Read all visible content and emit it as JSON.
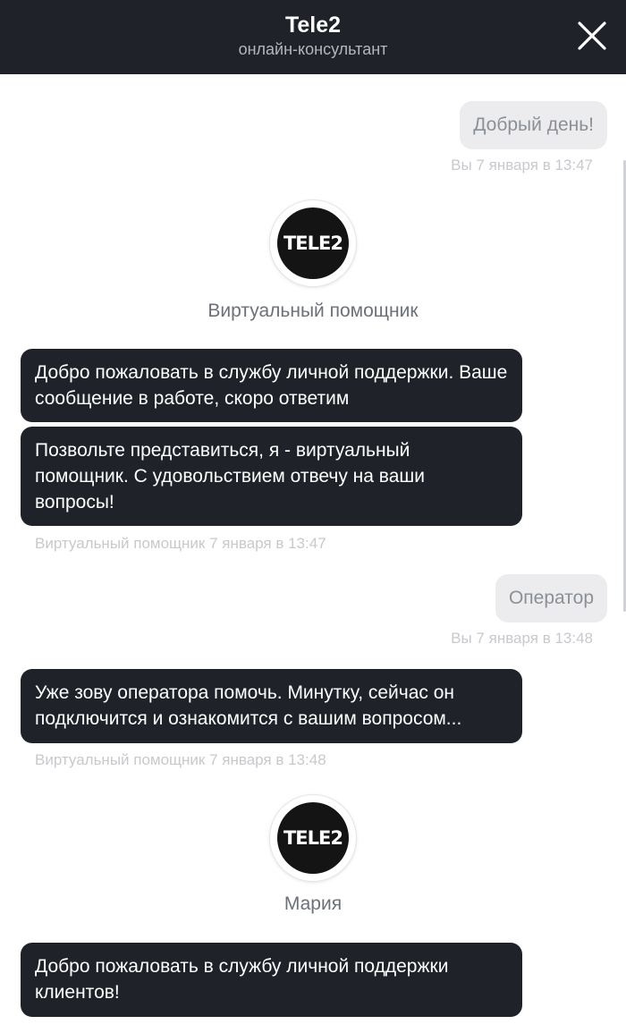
{
  "header": {
    "title": "Tele2",
    "subtitle": "онлайн-консультант",
    "close_icon": "close-icon"
  },
  "colors": {
    "header_bg": "#1f2229",
    "bot_bubble_bg": "#1f2229",
    "user_bubble_bg": "#ececee",
    "meta_text": "#c7c9cd"
  },
  "messages": [
    {
      "from": "user",
      "text": "Добрый день!",
      "meta": "Вы 7 января в 13:47"
    },
    {
      "agent": {
        "logo": "TELE2",
        "name": "Виртуальный помощник"
      }
    },
    {
      "from": "bot",
      "text": "Добро пожаловать в службу личной поддержки. Ваше сообщение в работе, скоро ответим"
    },
    {
      "from": "bot",
      "text": "Позвольте представиться, я - виртуальный помощник. С удовольствием отвечу на ваши вопросы!",
      "meta": "Виртуальный помощник 7 января в 13:47"
    },
    {
      "from": "user",
      "text": "Оператор",
      "meta": "Вы 7 января в 13:48"
    },
    {
      "from": "bot",
      "text": "Уже зову оператора помочь. Минутку, сейчас он подключится и ознакомится с вашим вопросом...",
      "meta": "Виртуальный помощник 7 января в 13:48"
    },
    {
      "agent": {
        "logo": "TELE2",
        "name": "Мария"
      }
    },
    {
      "from": "bot",
      "text": "Добро пожаловать в службу личной поддержки клиентов!"
    }
  ]
}
